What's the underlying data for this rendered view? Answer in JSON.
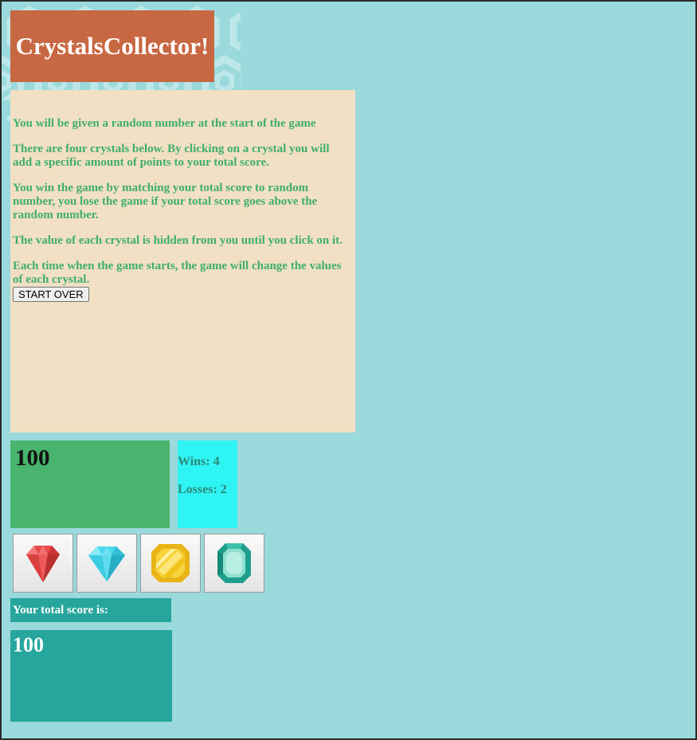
{
  "title": "CrystalsCollector!",
  "instructions": [
    "You will be given a random number at the start of the game",
    "There are four crystals below. By clicking on a crystal you will add a specific amount of points to your total score.",
    "You win the game by matching your total score to random number, you lose the game if your total score goes above the random number.",
    "The value of each crystal is hidden from you until you click on it.",
    "Each time when the game starts, the game will change the values of each crystal."
  ],
  "start_button_label": "START OVER",
  "random_number": "100",
  "wins_text": "Wins: 4",
  "losses_text": "Losses: 2",
  "crystals": [
    {
      "icon": "red-ruby-icon",
      "color": "#e84b4b"
    },
    {
      "icon": "blue-diamond-icon",
      "color": "#4dd8ec"
    },
    {
      "icon": "yellow-gem-icon",
      "color": "#f2c21b"
    },
    {
      "icon": "green-emerald-icon",
      "color": "#1f9e8c"
    }
  ],
  "score_label": "Your total score is:",
  "total_score": "100",
  "colors": {
    "title_bg": "#c86842",
    "panel_bg": "#f1e0c3",
    "instruction_text": "#3fae6b",
    "target_bg": "#48b46d",
    "winloss_bg": "#2ff4f4",
    "score_bg": "#27a69d",
    "page_bg": "#9ad9dc"
  }
}
